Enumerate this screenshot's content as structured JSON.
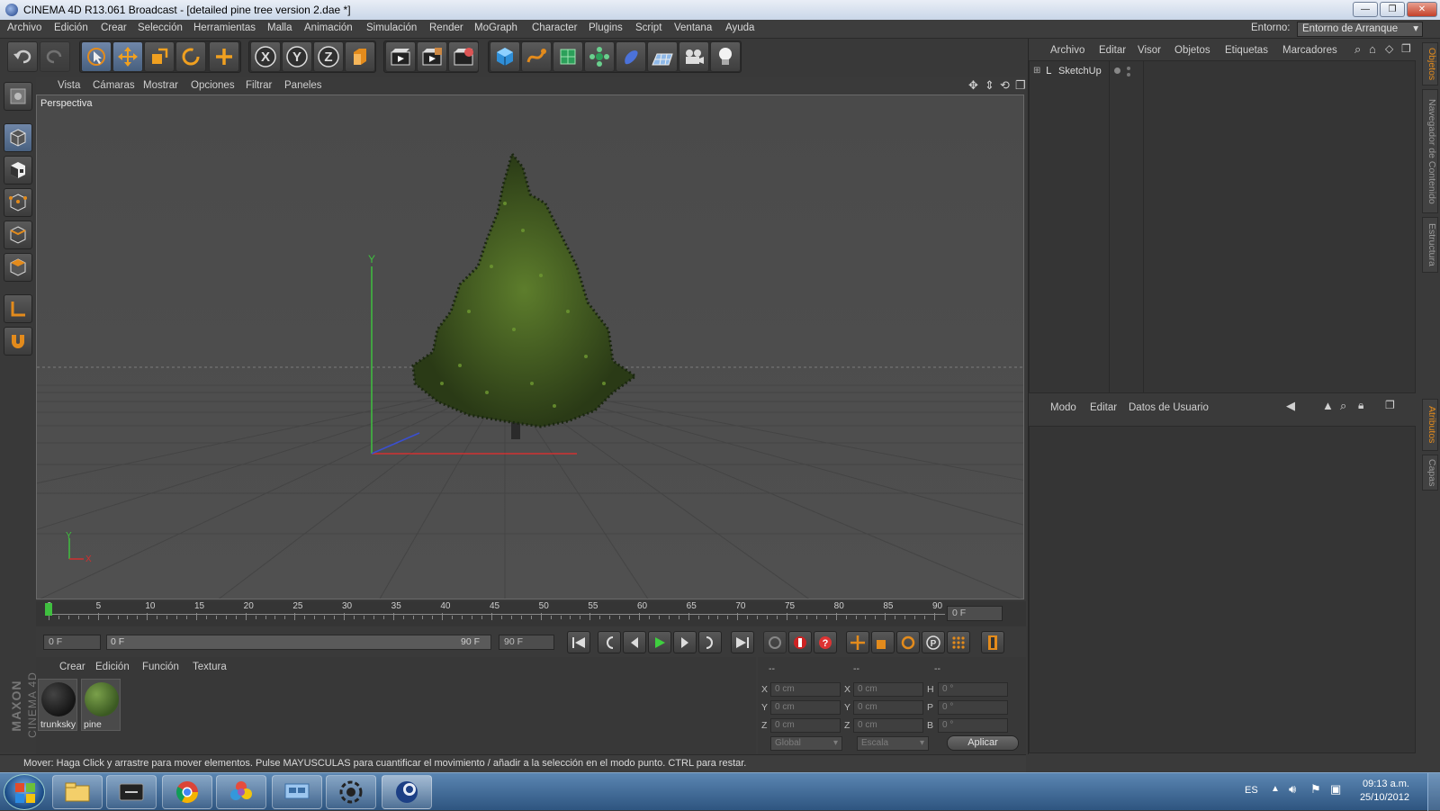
{
  "window": {
    "title": "CINEMA 4D R13.061 Broadcast - [detailed pine tree version 2.dae *]",
    "btn_min": "—",
    "btn_max": "❐",
    "btn_close": "✕"
  },
  "menubar": {
    "items": [
      "Archivo",
      "Edición",
      "Crear",
      "Selección",
      "Herramientas",
      "Malla",
      "Animación",
      "Simulación",
      "Render",
      "MoGraph",
      "Character",
      "Plugins",
      "Script",
      "Ventana",
      "Ayuda"
    ],
    "env_label": "Entorno:",
    "env_value": "Entorno de Arranque"
  },
  "toolbar": {
    "icons": [
      "undo-icon",
      "redo-icon",
      "select-icon",
      "move-icon",
      "scale-icon",
      "rotate-icon",
      "add-icon",
      "x-axis-icon",
      "y-axis-icon",
      "z-axis-icon",
      "coord-system-icon",
      "render-view-icon",
      "render-picture-icon",
      "render-settings-icon",
      "cube-icon",
      "spline-icon",
      "nurbs-icon",
      "array-icon",
      "deformer-icon",
      "floor-icon",
      "camera-icon",
      "light-icon"
    ],
    "axis_x": "X",
    "axis_y": "Y",
    "axis_z": "Z"
  },
  "viewport": {
    "menu": [
      "Vista",
      "Cámaras",
      "Mostrar",
      "Opciones",
      "Filtrar",
      "Paneles"
    ],
    "label": "Perspectiva",
    "gizmo_y": "Y",
    "gizmo_x": "X",
    "corner_y": "Y",
    "corner_x": "X"
  },
  "timeline": {
    "ticks": [
      "0",
      "5",
      "10",
      "15",
      "20",
      "25",
      "30",
      "35",
      "40",
      "45",
      "50",
      "55",
      "60",
      "65",
      "70",
      "75",
      "80",
      "85",
      "90"
    ],
    "current_frame": "0 F"
  },
  "transport": {
    "start_field": "0 F",
    "range_start": "0 F",
    "range_end": "90 F",
    "end_field": "90 F"
  },
  "materials": {
    "menu": [
      "Crear",
      "Edición",
      "Función",
      "Textura"
    ],
    "items": [
      {
        "name": "trunksky",
        "color": "#151515"
      },
      {
        "name": "pine",
        "color": "#3b5a22"
      }
    ]
  },
  "coords": {
    "headers": [
      "--",
      "--",
      "--"
    ],
    "rows": [
      {
        "a": "X",
        "va": "0 cm",
        "b": "X",
        "vb": "0 cm",
        "c": "H",
        "vc": "0 °"
      },
      {
        "a": "Y",
        "va": "0 cm",
        "b": "Y",
        "vb": "0 cm",
        "c": "P",
        "vc": "0 °"
      },
      {
        "a": "Z",
        "va": "0 cm",
        "b": "Z",
        "vb": "0 cm",
        "c": "B",
        "vc": "0 °"
      }
    ],
    "mode1": "Global",
    "mode2": "Escala",
    "apply": "Aplicar"
  },
  "status": {
    "text": "Mover: Haga Click y arrastre para mover elementos. Pulse MAYUSCULAS para cuantificar el movimiento / añadir a la selección en el modo punto. CTRL para restar."
  },
  "objects_panel": {
    "menu": [
      "Archivo",
      "Editar",
      "Visor",
      "Objetos",
      "Etiquetas",
      "Marcadores"
    ],
    "items": [
      {
        "name": "SketchUp"
      }
    ]
  },
  "attributes_panel": {
    "menu": [
      "Modo",
      "Editar",
      "Datos de Usuario"
    ]
  },
  "side_tabs": [
    "Objetos",
    "Navegador de Contenido",
    "Estructura",
    "Atributos",
    "Capas"
  ],
  "brand": {
    "line1": "MAXON",
    "line2": "CINEMA 4D"
  },
  "taskbar": {
    "apps": [
      "start-orb-icon",
      "file-explorer-icon",
      "media-center-icon",
      "chrome-icon",
      "picasa-icon",
      "network-icon",
      "cinema4d-lite-icon",
      "cinema4d-icon"
    ],
    "lang": "ES",
    "time": "09:13 a.m.",
    "date": "25/10/2012"
  },
  "colors": {
    "accent_orange": "#e38b1c",
    "viewport_bg": "#4c4c4c",
    "axis_green": "#3fbf3f",
    "axis_red": "#d03030",
    "axis_blue": "#3a4fd0"
  }
}
